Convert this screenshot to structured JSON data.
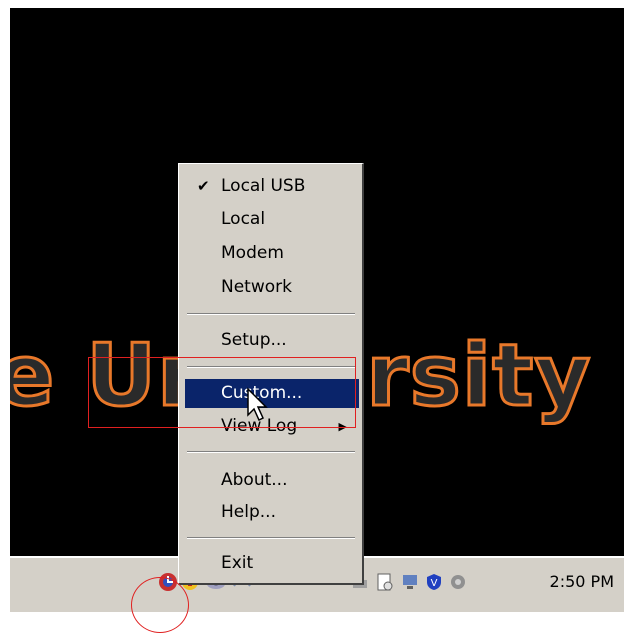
{
  "wallpaper": {
    "text": "e University",
    "colors": {
      "fill": "#2a2a2a",
      "outline": "#e8782a"
    }
  },
  "menu": {
    "items": [
      {
        "label": "Local USB",
        "checked": true
      },
      {
        "label": "Local"
      },
      {
        "label": "Modem"
      },
      {
        "label": "Network"
      },
      {
        "label": "Setup..."
      },
      {
        "label": "Custom...",
        "selected": true
      },
      {
        "label": "View Log",
        "submenu": true
      },
      {
        "label": "About..."
      },
      {
        "label": "Help..."
      },
      {
        "label": "Exit"
      }
    ],
    "check_glyph": "✔",
    "submenu_glyph": "▶",
    "selected_color": "#0a246a"
  },
  "taskbar": {
    "clock": "2:50 PM",
    "tray_icons": [
      "app-tray-icon",
      "shield-tray-icon",
      "disc-tray-icon",
      "network-tray-icon",
      "drive-tray-icon",
      "document-tray-icon",
      "monitor-tray-icon",
      "antivirus-tray-icon",
      "speaker-tray-icon"
    ]
  },
  "annotations": {
    "highlight_color": "#e02020"
  }
}
